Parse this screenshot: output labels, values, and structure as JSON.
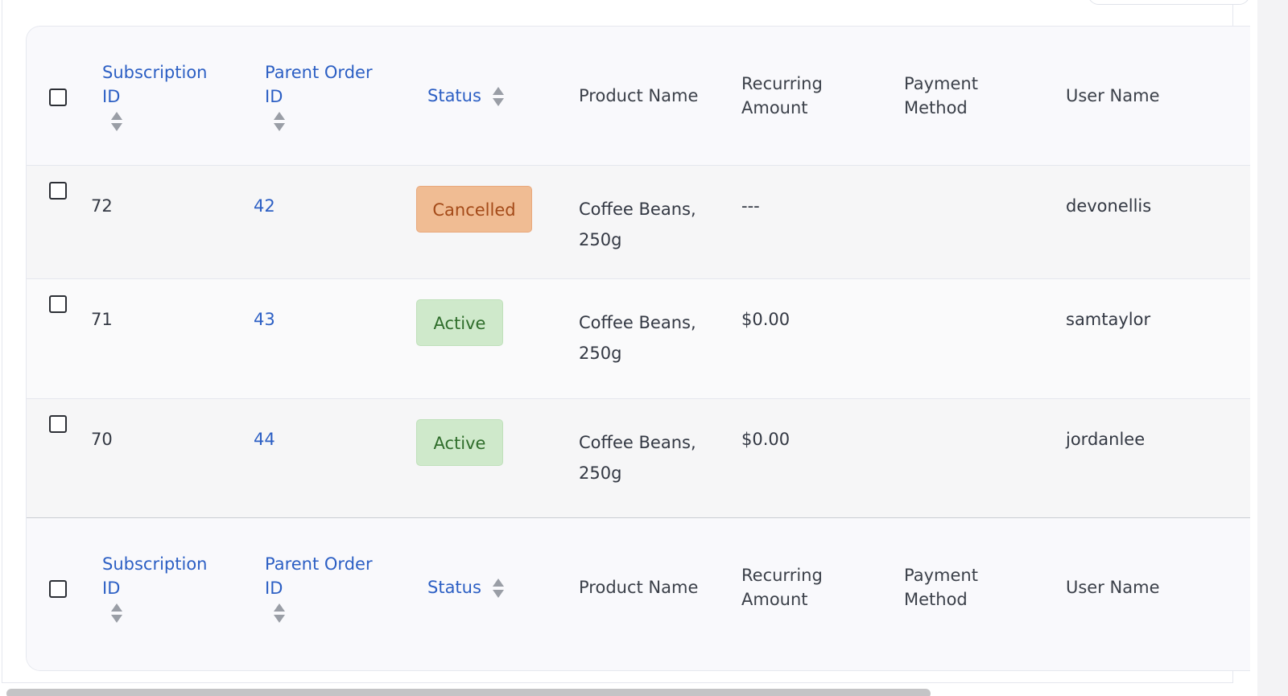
{
  "table": {
    "columns": [
      {
        "label": "Subscription ID",
        "sortable": true
      },
      {
        "label": "Parent Order ID",
        "sortable": true
      },
      {
        "label": "Status",
        "sortable": true
      },
      {
        "label": "Product Name",
        "sortable": false
      },
      {
        "label": "Recurring Amount",
        "sortable": false
      },
      {
        "label": "Payment Method",
        "sortable": false
      },
      {
        "label": "User Name",
        "sortable": false
      }
    ],
    "header": {
      "sub_id_l1": "Subscription",
      "sub_id_l2": "ID",
      "parent_l1": "Parent Order",
      "parent_l2": "ID",
      "status": "Status",
      "product": "Product Name",
      "amount_l1": "Recurring",
      "amount_l2": "Amount",
      "payment_l1": "Payment",
      "payment_l2": "Method",
      "user": "User Name"
    },
    "rows": [
      {
        "subscription_id": "72",
        "parent_order_id": "42",
        "status": "Cancelled",
        "product_l1": "Coffee Beans,",
        "product_l2": "250g",
        "recurring_amount": "---",
        "payment_method": "",
        "user_name": "devonellis"
      },
      {
        "subscription_id": "71",
        "parent_order_id": "43",
        "status": "Active",
        "product_l1": "Coffee Beans,",
        "product_l2": "250g",
        "recurring_amount": "$0.00",
        "payment_method": "",
        "user_name": "samtaylor"
      },
      {
        "subscription_id": "70",
        "parent_order_id": "44",
        "status": "Active",
        "product_l1": "Coffee Beans,",
        "product_l2": "250g",
        "recurring_amount": "$0.00",
        "payment_method": "",
        "user_name": "jordanlee"
      }
    ]
  },
  "colors": {
    "link": "#2c5fc4",
    "cancelled_bg": "#f0bc93",
    "cancelled_text": "#a44a18",
    "active_bg": "#cfe9cb",
    "active_text": "#2f6d2b"
  },
  "icons": {
    "sort": "sort-updown-icon"
  }
}
